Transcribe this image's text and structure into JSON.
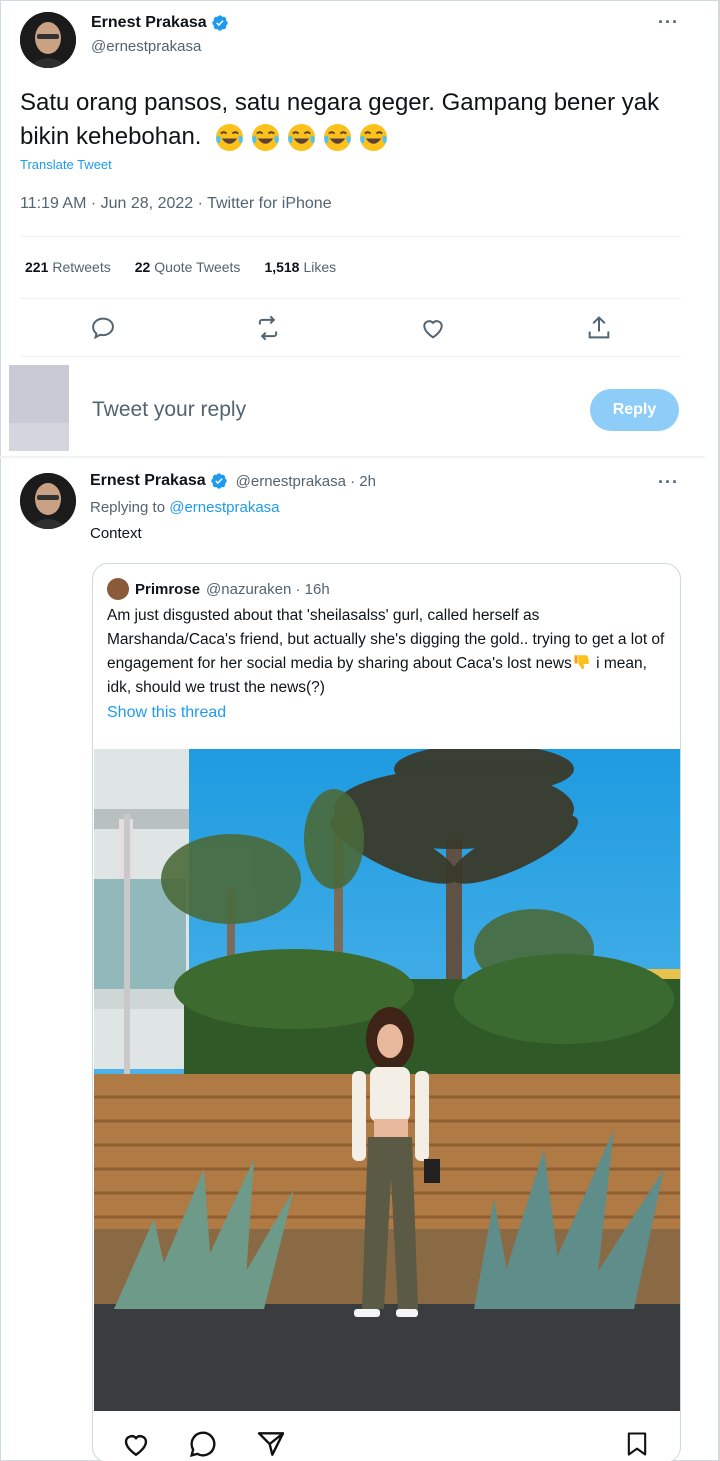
{
  "main_tweet": {
    "author_name": "Ernest Prakasa",
    "author_handle": "@ernestprakasa",
    "text": "Satu orang pansos, satu negara geger. Gampang bener yak bikin kehebohan.",
    "emoji": [
      "face-with-tears-of-joy",
      "face-with-tears-of-joy",
      "face-with-tears-of-joy",
      "face-with-tears-of-joy",
      "face-with-tears-of-joy"
    ],
    "translate_label": "Translate Tweet",
    "meta": "11:19 AM · Jun 28, 2022 · Twitter for iPhone",
    "stats": {
      "retweets_count": "221",
      "retweets_label": "Retweets",
      "quotes_count": "22",
      "quotes_label": "Quote Tweets",
      "likes_count": "1,518",
      "likes_label": "Likes"
    },
    "more_label": "···"
  },
  "reply_box": {
    "placeholder": "Tweet your reply",
    "button_label": "Reply"
  },
  "reply_tweet": {
    "author_name": "Ernest Prakasa",
    "author_handle_time": "@ernestprakasa · 2h",
    "replying_prefix": "Replying to",
    "replying_handle": "@ernestprakasa",
    "text": "Context",
    "more_label": "···",
    "quoted": {
      "author_name": "Primrose",
      "author_handle_time": "@nazuraken · 16h",
      "text_before_emoji": "Am just disgusted about that 'sheilasalss' gurl, called herself as Marshanda/Caca's friend, but actually she's digging the gold.. trying to get a lot of engagement for her social media by sharing about Caca's lost news",
      "text_after_emoji": " i mean, idk, should we trust the news(?)",
      "emoji": "thumbs-down",
      "show_thread_label": "Show this thread"
    }
  },
  "colors": {
    "accent": "#1d9bf0",
    "reply_button_disabled": "#8ecdf8",
    "secondary_text": "#536471",
    "divider": "#eff3f4"
  },
  "icons": [
    "verified-badge-icon",
    "reply-icon",
    "retweet-icon",
    "like-icon",
    "share-icon",
    "heart-icon",
    "comment-icon",
    "send-icon",
    "bookmark-icon"
  ]
}
